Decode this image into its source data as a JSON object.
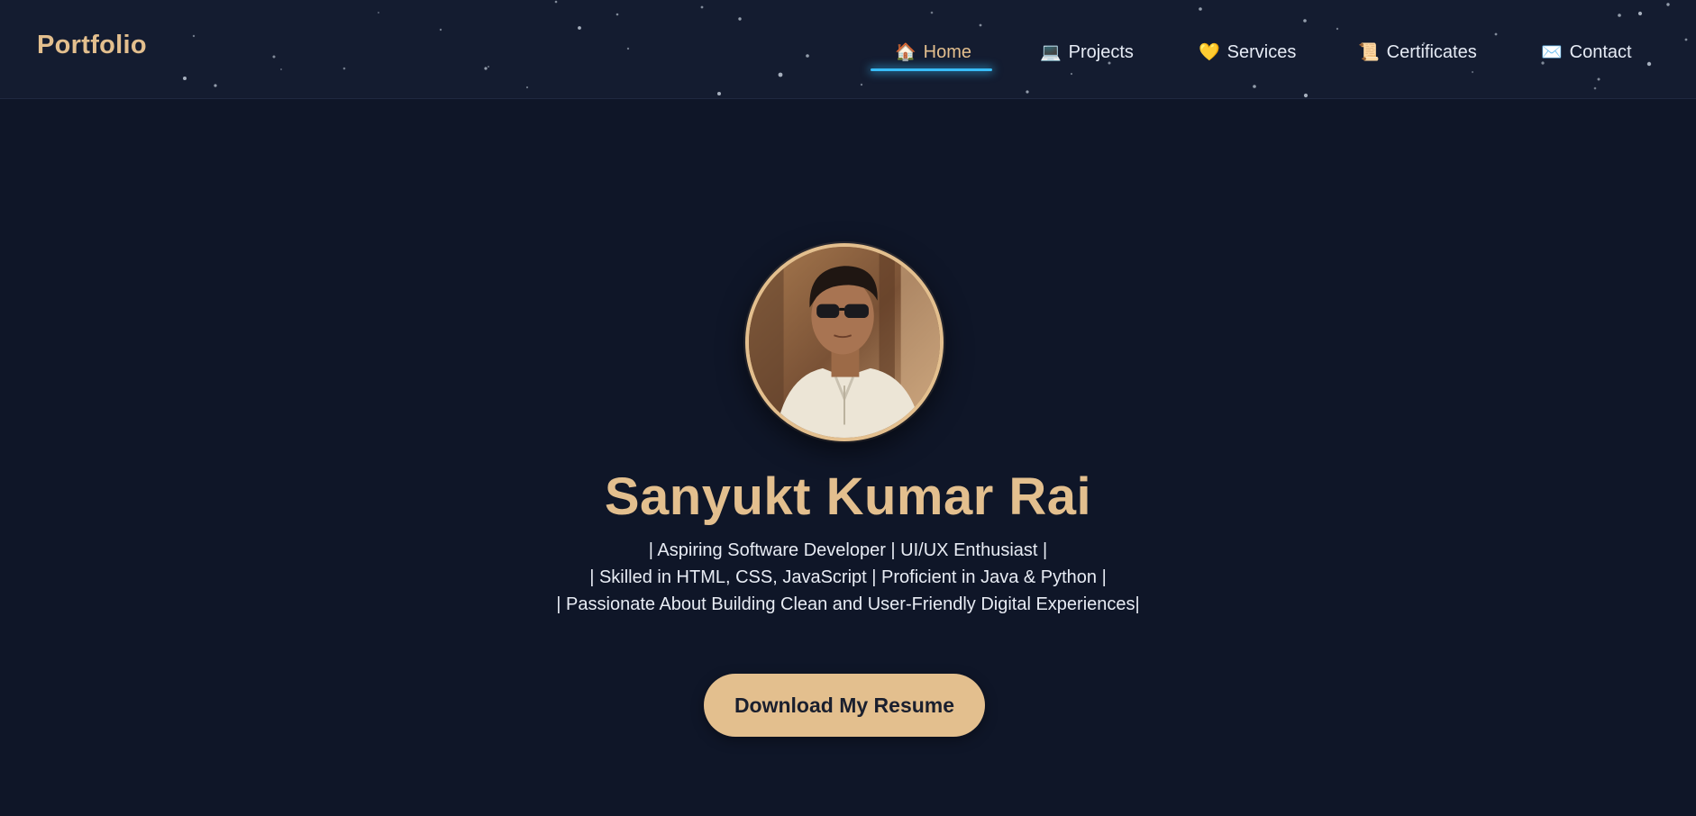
{
  "navbar": {
    "brand": "Portfolio",
    "items": [
      {
        "label": "Home",
        "icon": "🏠",
        "icon_name": "house-icon",
        "active": true
      },
      {
        "label": "Projects",
        "icon": "💻",
        "icon_name": "laptop-icon",
        "active": false
      },
      {
        "label": "Services",
        "icon": "💛",
        "icon_name": "heart-icon",
        "active": false
      },
      {
        "label": "Certificates",
        "icon": "📜",
        "icon_name": "scroll-icon",
        "active": false
      },
      {
        "label": "Contact",
        "icon": "✉️",
        "icon_name": "envelope-icon",
        "active": false
      }
    ]
  },
  "hero": {
    "name": "Sanyukt Kumar Rai",
    "taglines": [
      "| Aspiring Software Developer | UI/UX Enthusiast |",
      "| Skilled in HTML, CSS, JavaScript | Proficient in Java & Python |",
      "| Passionate About Building Clean and User-Friendly Digital Experiences|"
    ],
    "resume_button": "Download My Resume"
  },
  "colors": {
    "background": "#0f1628",
    "navbar_bg": "#141c30",
    "accent_gold": "#e3bf8e",
    "active_underline": "#38bdf8",
    "text_light": "#e8ecf4"
  }
}
